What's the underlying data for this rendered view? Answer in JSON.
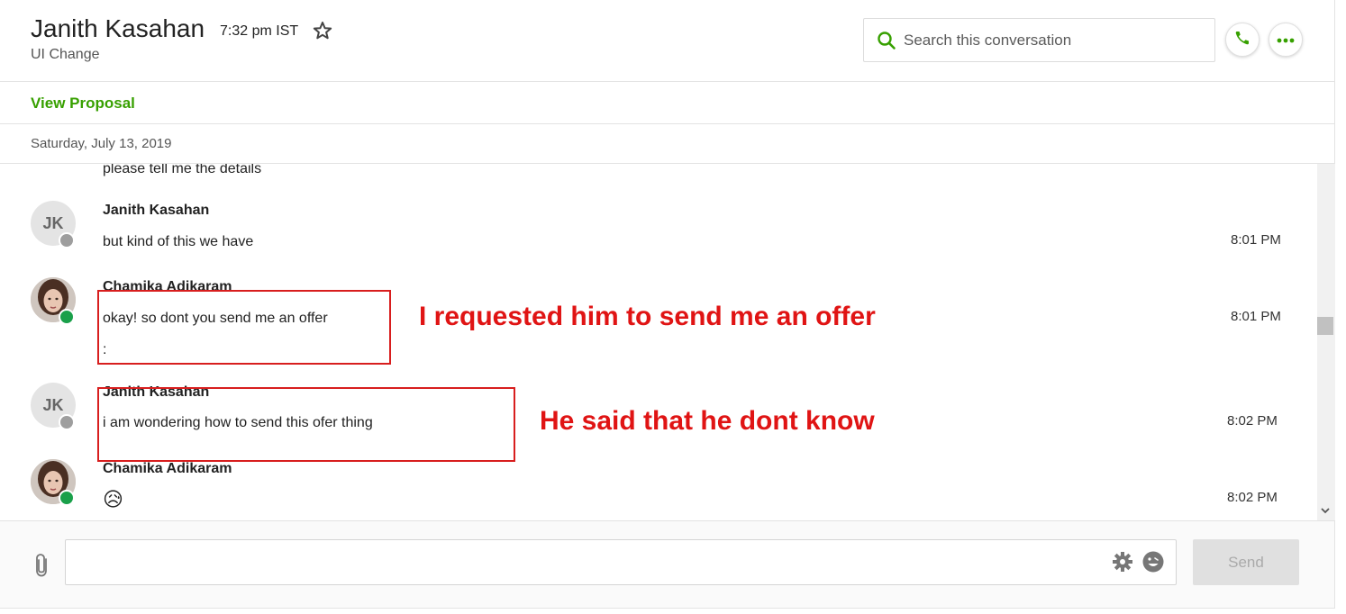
{
  "header": {
    "contact_name": "Janith Kasahan",
    "local_time": "7:32 pm IST",
    "job_title": "UI Change",
    "search_placeholder": "Search this conversation"
  },
  "proposal": {
    "link_label": "View Proposal"
  },
  "date_divider": "Saturday, July 13, 2019",
  "messages": [
    {
      "text": "please tell me the details"
    },
    {
      "sender": "Janith Kasahan",
      "avatar_initials": "JK",
      "text": "but kind of this we have",
      "time": "8:01 PM"
    },
    {
      "sender": "Chamika Adikaram",
      "text": "okay! so dont you send me an offer",
      "text2": ":",
      "time": "8:01 PM"
    },
    {
      "sender": "Janith Kasahan",
      "avatar_initials": "JK",
      "text": "i am wondering how to send this ofer thing",
      "time": "8:02 PM"
    },
    {
      "sender": "Chamika Adikaram",
      "text": "😥",
      "time": "8:02 PM"
    }
  ],
  "annotations": [
    {
      "text": "I requested him to send me an offer"
    },
    {
      "text": "He said that he dont know"
    }
  ],
  "composer": {
    "send_label": "Send"
  },
  "colors": {
    "brand_green": "#37a000",
    "annotation_red": "#e01414",
    "online": "#1aa04a",
    "offline": "#9e9e9e"
  },
  "icons": [
    "star-icon",
    "search-icon",
    "phone-icon",
    "more-icon",
    "paperclip-icon",
    "gear-icon",
    "emoji-icon",
    "chevron-down-icon"
  ]
}
